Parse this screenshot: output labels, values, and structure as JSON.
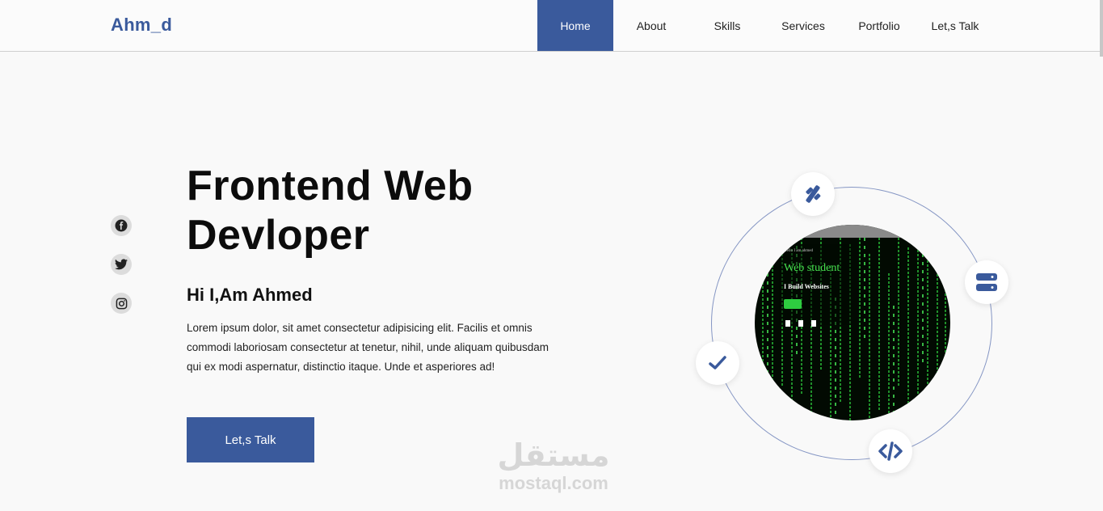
{
  "header": {
    "logo": "Ahm_d",
    "nav": [
      {
        "label": "Home",
        "active": true
      },
      {
        "label": "About"
      },
      {
        "label": "Skills"
      },
      {
        "label": "Services"
      },
      {
        "label": "Portfolio"
      },
      {
        "label": "Let,s Talk"
      }
    ]
  },
  "social": [
    "facebook-icon",
    "twitter-icon",
    "instagram-icon"
  ],
  "hero": {
    "title_line1": "Frontend Web",
    "title_line2": "Devloper",
    "subtitle": "Hi I,Am Ahmed",
    "description": "Lorem ipsum dolor, sit amet consectetur adipisicing elit. Facilis et omnis commodi laboriosam consectetur at tenetur, nihil, unde aliquam quibusdam qui ex modi aspernatur, distinctio itaque. Unde et asperiores ad!",
    "cta_label": "Let,s Talk"
  },
  "photo": {
    "small_text": "Hello I am ahmed",
    "headline": "Web student",
    "tagline": "I Build Websites"
  },
  "orbit_icons": [
    "tools-icon",
    "server-icon",
    "check-icon",
    "code-icon"
  ],
  "watermark": {
    "arabic": "مستقل",
    "latin": "mostaql.com"
  },
  "colors": {
    "accent": "#3a5a9c",
    "background": "#f9f9f9",
    "matrix_green": "#47e14f"
  }
}
